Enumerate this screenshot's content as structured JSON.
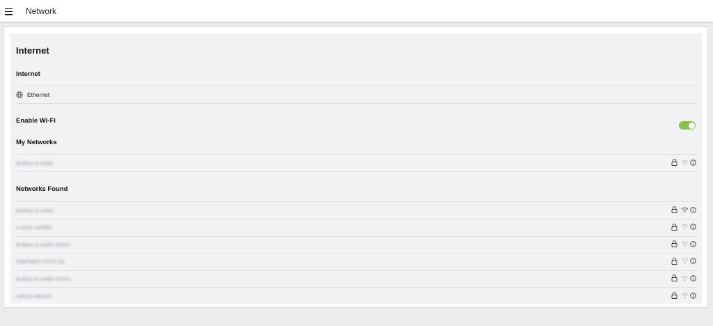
{
  "header": {
    "title": "Network",
    "menu_icon": "hamburger-menu-icon"
  },
  "panel": {
    "title": "Internet",
    "internet_section": {
      "heading": "Internet",
      "connection": {
        "icon": "globe-icon",
        "label": "Ethernet"
      }
    },
    "wifi": {
      "label": "Enable Wi-Fi",
      "enabled": true,
      "toggle_color": "#8cc04a"
    },
    "my_networks": {
      "heading": "My Networks",
      "items": [
        {
          "name": "Buffalo-A-A480",
          "secured": true,
          "signal": "weak"
        }
      ]
    },
    "networks_found": {
      "heading": "Networks Found",
      "items": [
        {
          "name": "Buffalo-G-A480",
          "secured": true,
          "signal": "strong"
        },
        {
          "name": "a-tomo-2a5f86",
          "secured": true,
          "signal": "weak"
        },
        {
          "name": "Buffalo-A-A480-WPA3",
          "secured": true,
          "signal": "weak"
        },
        {
          "name": "DIMPMEX-F673-2G",
          "secured": true,
          "signal": "weak"
        },
        {
          "name": "Buffalo-G-A480-WPA3",
          "secured": true,
          "signal": "weak"
        },
        {
          "name": "HR02a-8B9CE",
          "secured": true,
          "signal": "weak"
        }
      ]
    }
  }
}
